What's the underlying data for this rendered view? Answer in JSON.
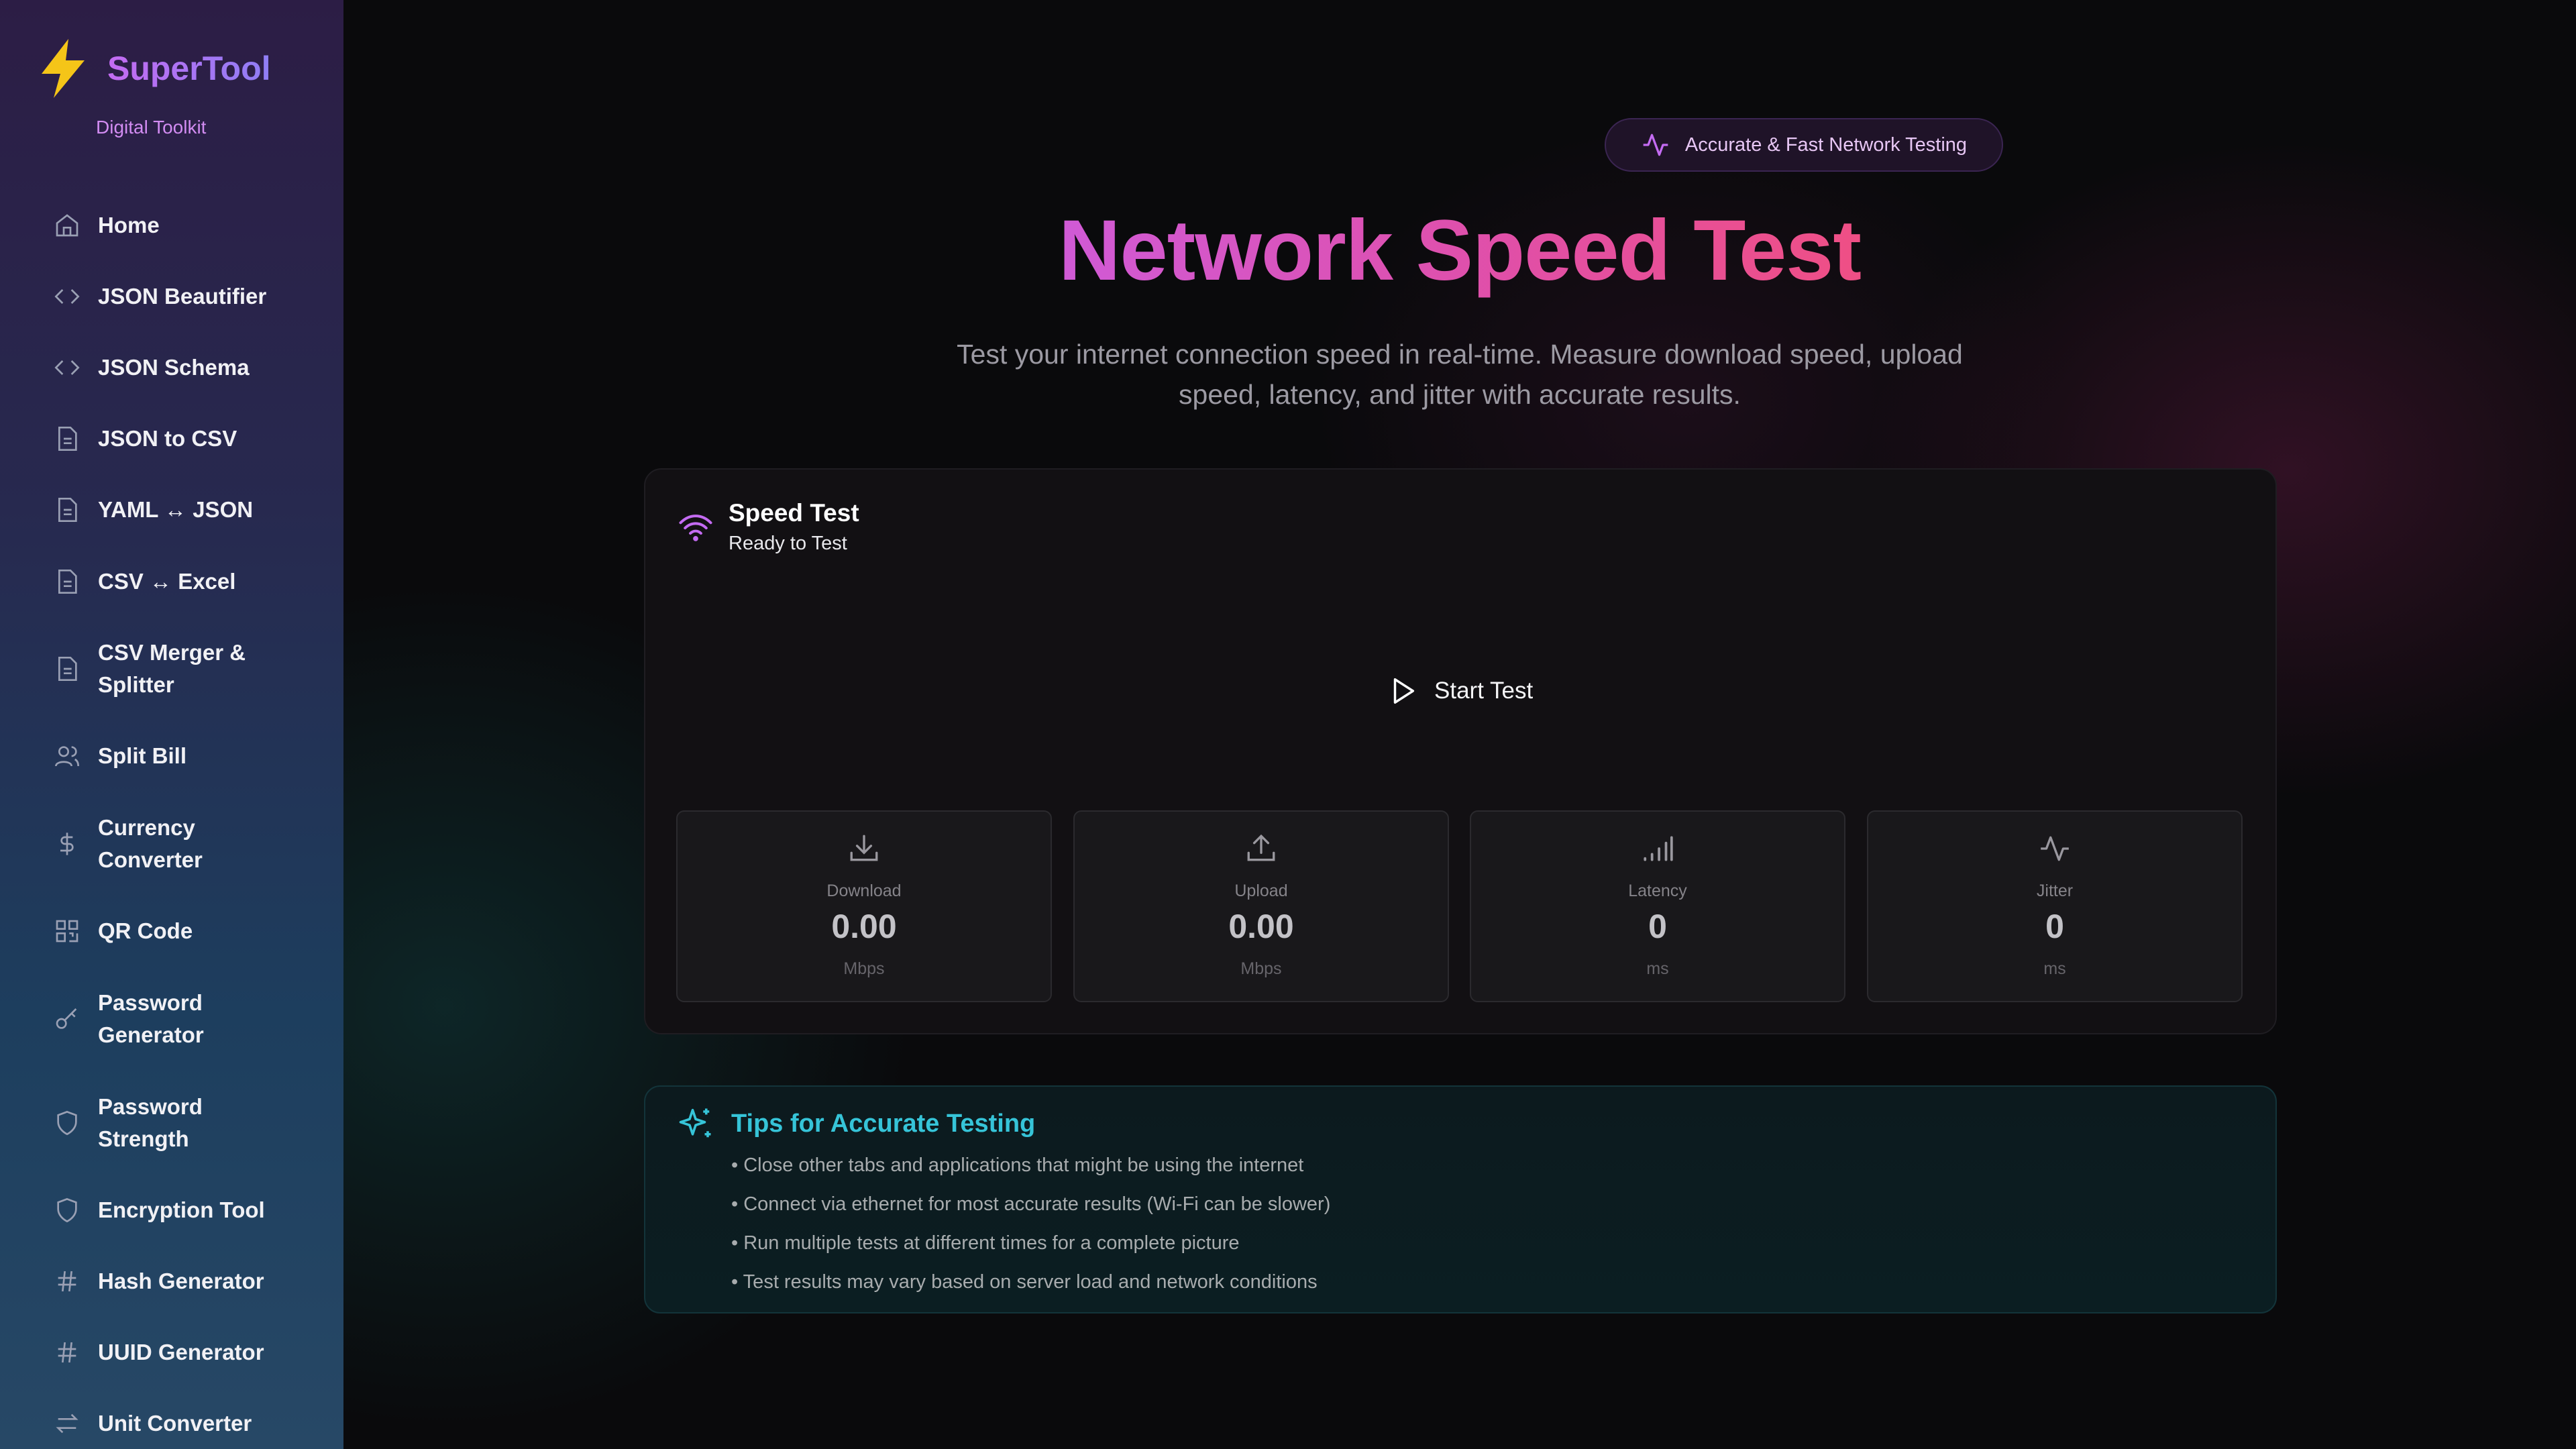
{
  "brand": {
    "title": "SuperTool",
    "subtitle": "Digital Toolkit"
  },
  "sidebar": {
    "items": [
      {
        "label": "Home",
        "icon": "home-icon"
      },
      {
        "label": "JSON Beautifier",
        "icon": "code-icon"
      },
      {
        "label": "JSON Schema",
        "icon": "code-icon"
      },
      {
        "label": "JSON to CSV",
        "icon": "file-icon"
      },
      {
        "label": "YAML ↔ JSON",
        "icon": "file-icon"
      },
      {
        "label": "CSV ↔ Excel",
        "icon": "file-icon"
      },
      {
        "label": "CSV Merger & Splitter",
        "icon": "file-icon"
      },
      {
        "label": "Split Bill",
        "icon": "users-icon"
      },
      {
        "label": "Currency Converter",
        "icon": "dollar-icon"
      },
      {
        "label": "QR Code",
        "icon": "qr-icon"
      },
      {
        "label": "Password Generator",
        "icon": "key-icon"
      },
      {
        "label": "Password Strength",
        "icon": "shield-icon"
      },
      {
        "label": "Encryption Tool",
        "icon": "shield-icon"
      },
      {
        "label": "Hash Generator",
        "icon": "hash-icon"
      },
      {
        "label": "UUID Generator",
        "icon": "hash-icon"
      },
      {
        "label": "Unit Converter",
        "icon": "swap-icon"
      }
    ]
  },
  "hero": {
    "badge": "Accurate & Fast Network Testing",
    "title": "Network Speed Test",
    "subtitle": "Test your internet connection speed in real-time. Measure download speed, upload speed, latency, and jitter with accurate results."
  },
  "speed_test": {
    "title": "Speed Test",
    "status": "Ready to Test",
    "start_label": "Start Test",
    "metrics": [
      {
        "label": "Download",
        "value": "0.00",
        "unit": "Mbps",
        "icon": "download-icon"
      },
      {
        "label": "Upload",
        "value": "0.00",
        "unit": "Mbps",
        "icon": "upload-icon"
      },
      {
        "label": "Latency",
        "value": "0",
        "unit": "ms",
        "icon": "signal-icon"
      },
      {
        "label": "Jitter",
        "value": "0",
        "unit": "ms",
        "icon": "activity-icon"
      }
    ]
  },
  "tips": {
    "title": "Tips for Accurate Testing",
    "items": [
      "• Close other tabs and applications that might be using the internet",
      "• Connect via ethernet for most accurate results (Wi-Fi can be slower)",
      "• Run multiple tests at different times for a complete picture",
      "• Test results may vary based on server load and network conditions"
    ]
  },
  "colors": {
    "accent_purple": "#c46bf2",
    "title_pink": "#e04fa8",
    "tips_cyan": "#36c4d8",
    "brand_bolt": "#f5c518"
  }
}
